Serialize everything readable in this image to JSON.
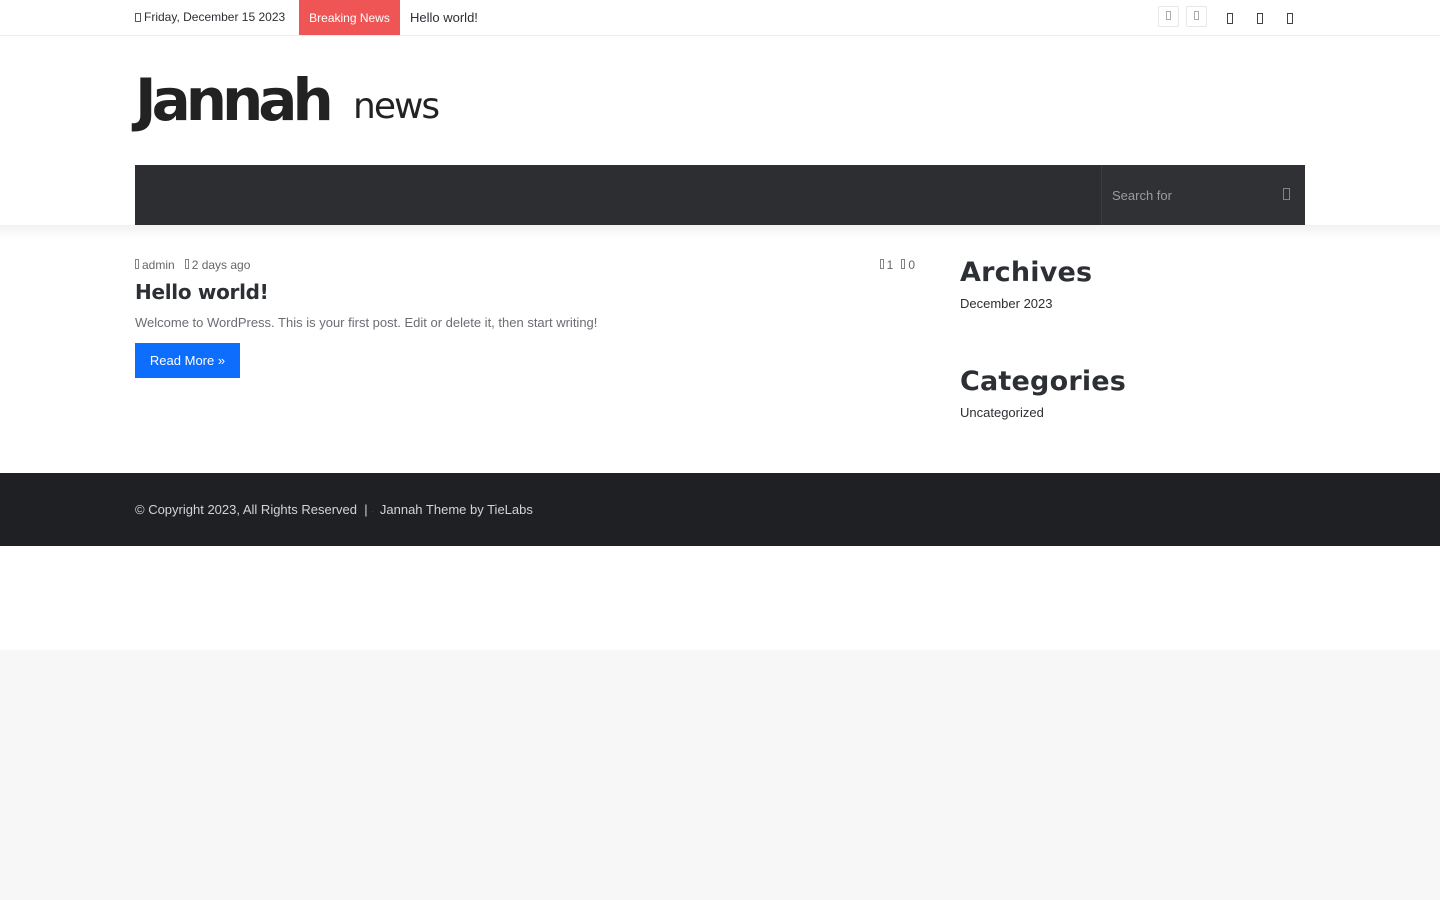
{
  "topbar": {
    "date": "Friday, December 15 2023",
    "breaking_label": "Breaking News",
    "breaking_item": "Hello world!"
  },
  "header": {
    "logo_main": "Jannah",
    "logo_sub": "news"
  },
  "nav": {
    "search_placeholder": "Search for"
  },
  "post": {
    "author": "admin",
    "time": "2 days ago",
    "views": "1",
    "comments": "0",
    "title": "Hello world!",
    "excerpt": "Welcome to WordPress. This is your first post. Edit or delete it, then start writing!",
    "read_more": "Read More »"
  },
  "sidebar": {
    "archives_title": "Archives",
    "archives_link": "December 2023",
    "categories_title": "Categories",
    "categories_link": "Uncategorized"
  },
  "footer": {
    "copyright": "© Copyright 2023, All Rights Reserved",
    "separator": "|",
    "theme_credit": "Jannah Theme by TieLabs"
  },
  "colors": {
    "breaking": "#f05555",
    "button": "#0d6efd",
    "nav": "#2c2e32",
    "footer": "#1f2024"
  }
}
